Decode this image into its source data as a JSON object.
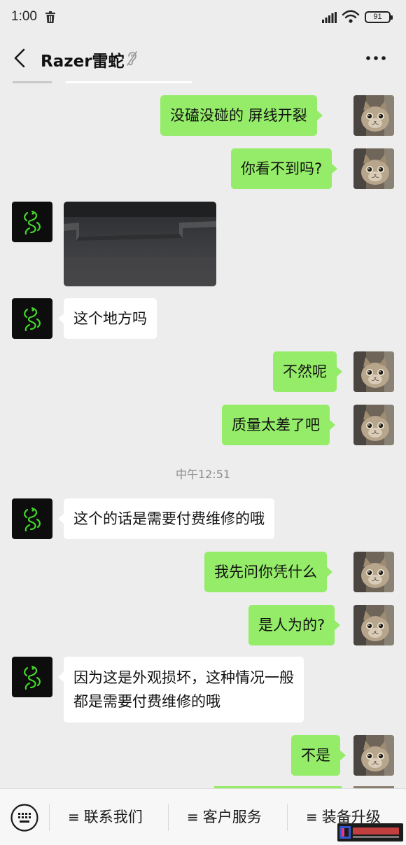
{
  "status_bar": {
    "time": "1:00",
    "battery": "91"
  },
  "header": {
    "back_icon": "chevron-left-icon",
    "title": "Razer雷蛇",
    "ear_icon": "ear-icon",
    "more_icon": "ellipsis-icon"
  },
  "messages": [
    {
      "side": "sent",
      "text": "没磕没碰的  屏线开裂"
    },
    {
      "side": "sent",
      "text": "你看不到吗?"
    },
    {
      "side": "received",
      "type": "image"
    },
    {
      "side": "received",
      "text": "这个地方吗"
    },
    {
      "side": "sent",
      "text": "不然呢"
    },
    {
      "side": "sent",
      "text": "质量太差了吧"
    },
    {
      "type": "timestamp",
      "text": "中午12:51"
    },
    {
      "side": "received",
      "text": "这个的话是需要付费维修的哦"
    },
    {
      "side": "sent",
      "text": "我先问你凭什么"
    },
    {
      "side": "sent",
      "text": "是人为的?"
    },
    {
      "side": "received",
      "lines": [
        "因为这是外观损坏，这种情况一般",
        "都是需要付费维修的哦"
      ]
    },
    {
      "side": "sent",
      "text": "不是"
    }
  ],
  "menu": {
    "keyboard_icon": "keyboard-icon",
    "glyph": "≡",
    "items": [
      "联系我们",
      "客户服务",
      "装备升级"
    ]
  },
  "colors": {
    "background": "#ededed",
    "sent_bubble": "#95ec69",
    "received_bubble": "#ffffff",
    "menu_bar": "#f7f7f7"
  }
}
